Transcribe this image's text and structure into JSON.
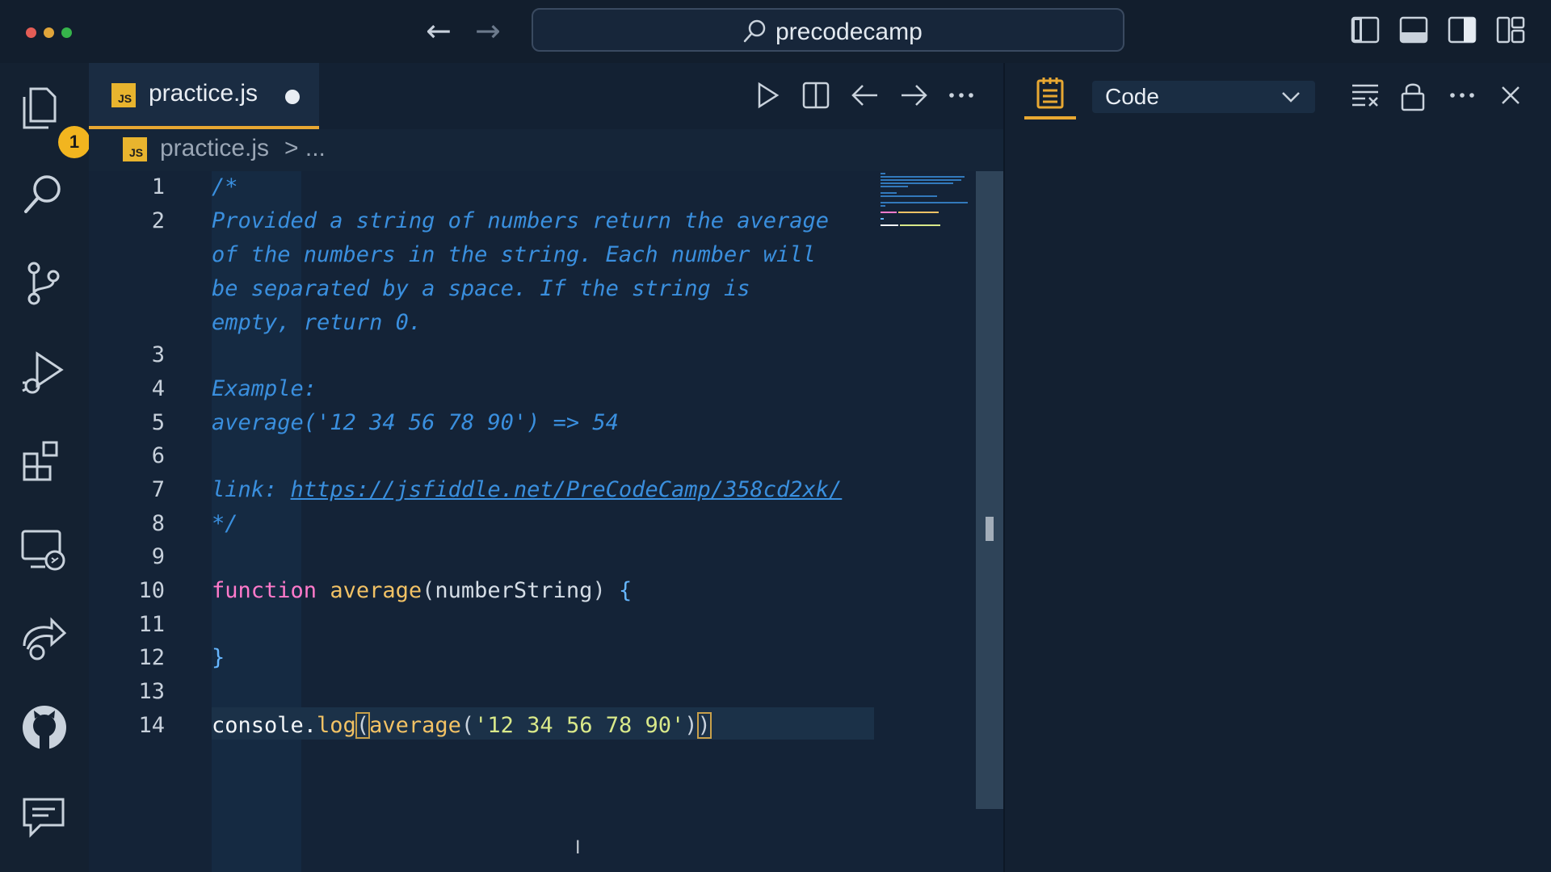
{
  "titlebar": {
    "search_text": "precodecamp"
  },
  "activity_bar": {
    "explorer_badge": "1"
  },
  "tab": {
    "icon_text": "JS",
    "label": "practice.js"
  },
  "breadcrumb": {
    "icon_text": "JS",
    "file": "practice.js",
    "separator": "> ..."
  },
  "editor": {
    "lines": [
      {
        "n": "1",
        "text": "/*"
      },
      {
        "n": "2",
        "text": "Provided a string of numbers return the average"
      },
      {
        "n": "",
        "text": "of the numbers in the string. Each number will"
      },
      {
        "n": "",
        "text": "be separated by a space. If the string is"
      },
      {
        "n": "",
        "text": "empty, return 0."
      },
      {
        "n": "3",
        "text": ""
      },
      {
        "n": "4",
        "text": "Example:"
      },
      {
        "n": "5",
        "text": "average('12 34 56 78 90') => 54"
      },
      {
        "n": "6",
        "text": ""
      },
      {
        "n": "7",
        "text": "link: ",
        "link": "https://jsfiddle.net/PreCodeCamp/358cd2xk/"
      },
      {
        "n": "8",
        "text": "*/"
      },
      {
        "n": "9",
        "text": ""
      },
      {
        "n": "10",
        "kw": "function",
        "fn": "average",
        "params": "numberString",
        "open": "{"
      },
      {
        "n": "11",
        "text": ""
      },
      {
        "n": "12",
        "close": "}"
      },
      {
        "n": "13",
        "text": ""
      },
      {
        "n": "14",
        "obj": "console.",
        "method": "log",
        "call": "average",
        "arg": "'12 34 56 78 90'"
      }
    ]
  },
  "right_panel": {
    "select_value": "Code"
  },
  "colors": {
    "accent": "#e8a832",
    "comment": "#3a8fde",
    "keyword": "#ff7acb",
    "function": "#f2c265",
    "string": "#d9e98a"
  }
}
